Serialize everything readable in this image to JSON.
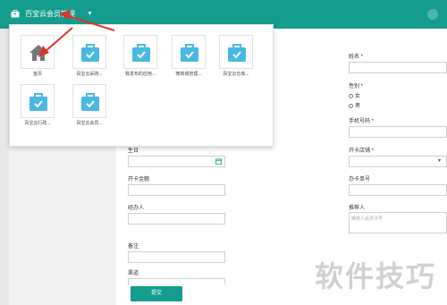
{
  "header": {
    "app_title": "百宝云会员管理",
    "caret": "▼"
  },
  "popup": {
    "tiles": [
      {
        "label": "首页",
        "icon": "home-icon"
      },
      {
        "label": "百宝云采购...",
        "icon": "bag-icon"
      },
      {
        "label": "我发布的应用...",
        "icon": "bag-icon"
      },
      {
        "label": "微商城管理...",
        "icon": "bag-icon"
      },
      {
        "label": "百宝云仓库...",
        "icon": "bag-icon"
      },
      {
        "label": "百宝云行政...",
        "icon": "bag-icon"
      },
      {
        "label": "百宝云会员...",
        "icon": "bag-icon"
      }
    ]
  },
  "form": {
    "birthday_label": "生日",
    "card_amount_label": "开卡金额",
    "handler_label": "经办人",
    "remark_label": "备注",
    "source_label": "渠道",
    "name_label": "姓名 *",
    "gender_label": "性别 *",
    "gender_female": "女",
    "gender_male": "男",
    "phone_label": "手机号码 *",
    "store_label": "开卡店铺 *",
    "card_no_label": "办卡单号",
    "referrer_label": "推荐人",
    "referrer_placeholder": "推荐人会员卡号",
    "submit_label": "提交"
  },
  "watermark": "软件技巧",
  "colors": {
    "accent": "#149d8f",
    "arrow": "#d9352b",
    "icon": "#4ab8e3"
  }
}
